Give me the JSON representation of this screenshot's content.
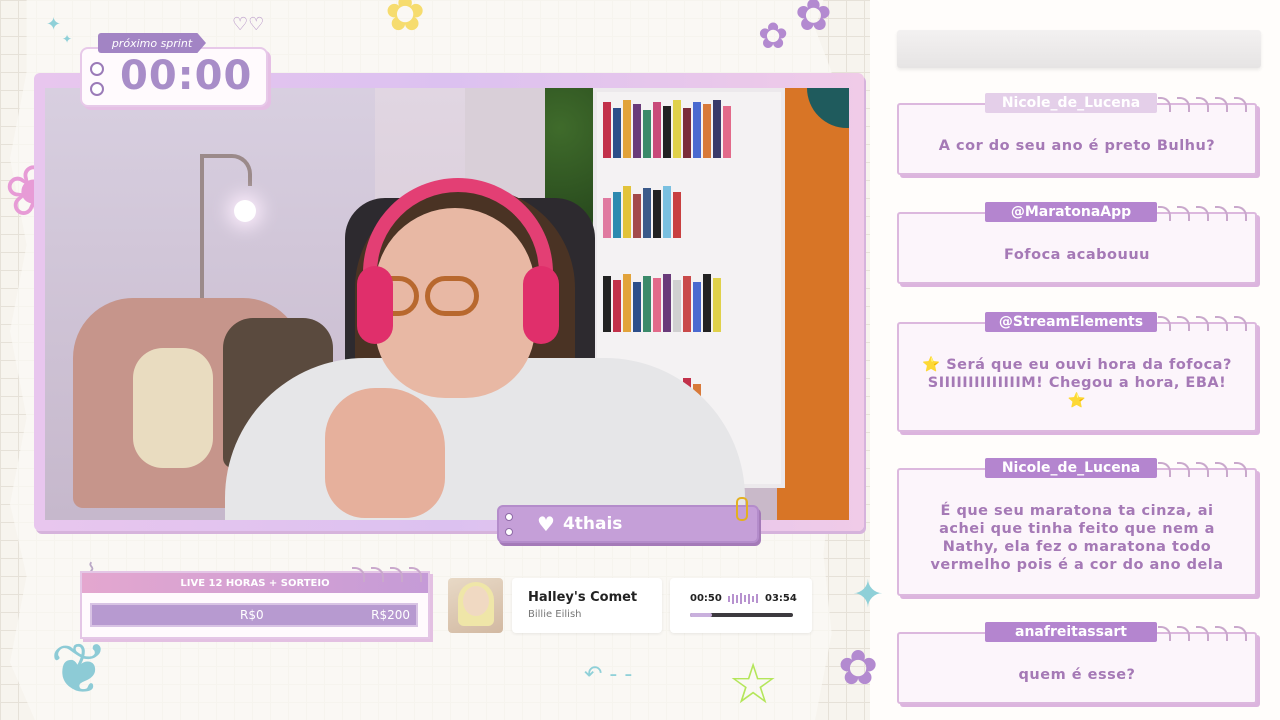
{
  "timer": {
    "label": "próximo sprint",
    "value": "00:00"
  },
  "streamer": {
    "name": "4thais"
  },
  "goal": {
    "title": "LIVE 12 HORAS + SORTEIO",
    "current": "R$0",
    "target": "R$200",
    "progress": 0.0
  },
  "music": {
    "title": "Halley's Comet",
    "artist": "Billie Eilish",
    "elapsed": "00:50",
    "total": "03:54",
    "progress": 0.214
  },
  "chat": [
    {
      "user": "Nicole_de_Lucena",
      "message": "A cor do seu ano é preto Bulhu?"
    },
    {
      "user": "@MaratonaApp",
      "message": "Fofoca acabouuu"
    },
    {
      "user": "@StreamElements",
      "message": "⭐ Será que eu ouvi hora da fofoca? SIIIIIIIIIIIIIIM! Chegou a hora, EBA! ⭐"
    },
    {
      "user": "Nicole_de_Lucena",
      "message": "É que seu maratona ta cinza, ai achei que tinha feito que nem a Nathy, ela fez o maratona todo vermelho pois é a cor do ano dela"
    },
    {
      "user": "anafreitassart",
      "message": "quem é esse?"
    }
  ],
  "colors": {
    "accent": "#b485cf",
    "frame": "#e8c6ee",
    "text": "#a579b6"
  },
  "icons": [
    "heart-icon",
    "paperclip-icon",
    "flower-icon",
    "butterfly-icon",
    "star-icon"
  ]
}
